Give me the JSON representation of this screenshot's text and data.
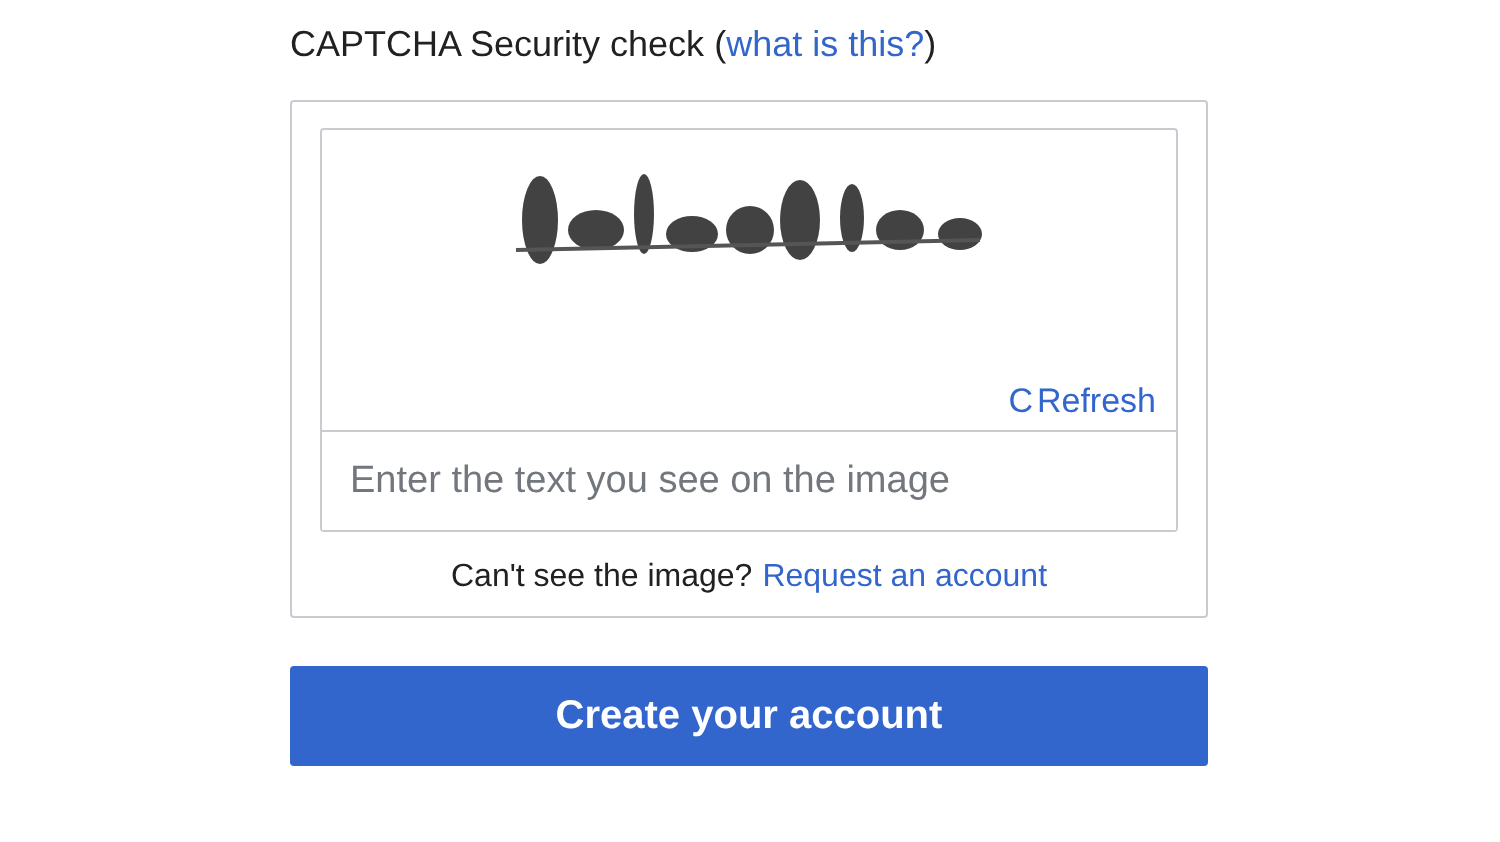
{
  "captcha": {
    "label": "CAPTCHA Security check",
    "open_paren": "(",
    "help_link": "what is this?",
    "close_paren": ")",
    "refresh": {
      "icon": "C",
      "label": "Refresh"
    },
    "answer": {
      "placeholder": "Enter the text you see on the image"
    },
    "help_text": "Can't see the image?",
    "help_action": "Request an account"
  },
  "submit": {
    "label": "Create your account"
  }
}
